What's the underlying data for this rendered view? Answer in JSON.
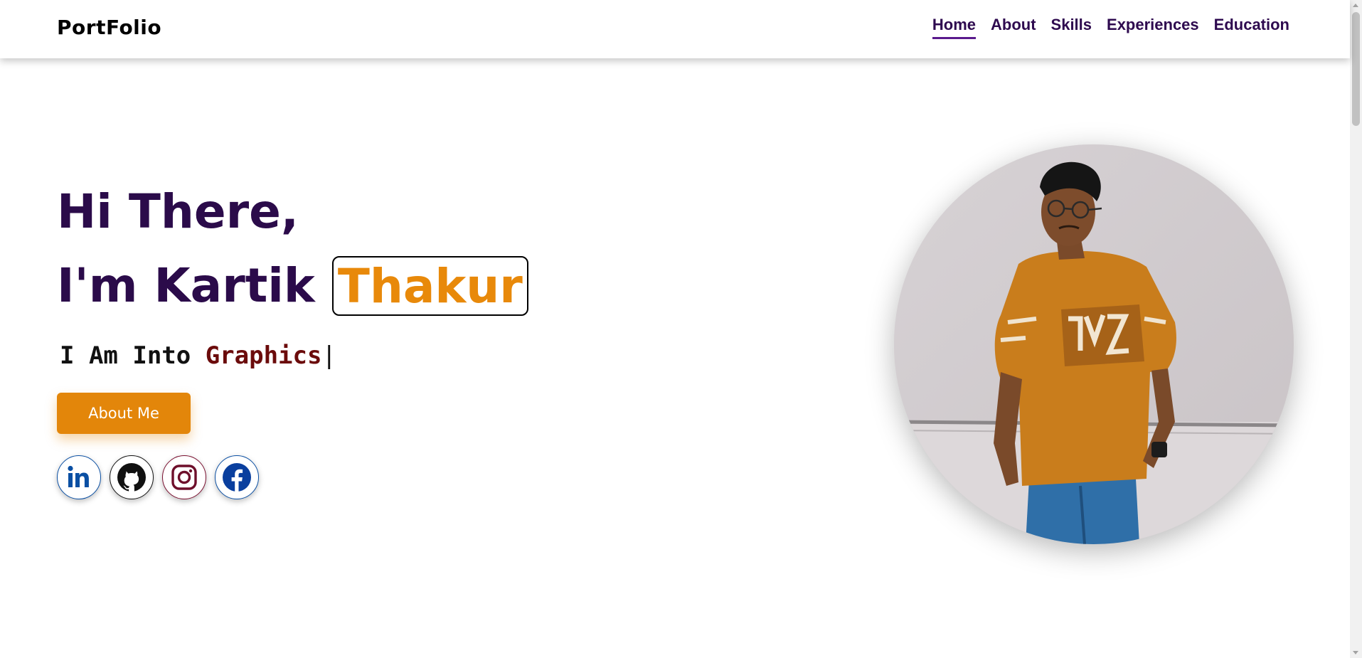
{
  "header": {
    "brand": "PortFolio",
    "nav": [
      {
        "label": "Home",
        "active": true
      },
      {
        "label": "About",
        "active": false
      },
      {
        "label": "Skills",
        "active": false
      },
      {
        "label": "Experiences",
        "active": false
      },
      {
        "label": "Education",
        "active": false
      }
    ]
  },
  "hero": {
    "greeting": "Hi There,",
    "intro_prefix": "I'm Kartik",
    "last_name": "Thakur",
    "typed_prefix": "I Am Into ",
    "typed_word": "Graphics",
    "typed_cursor": "|",
    "about_button": "About Me"
  },
  "socials": [
    {
      "name": "linkedin",
      "icon": "linkedin-icon"
    },
    {
      "name": "github",
      "icon": "github-icon"
    },
    {
      "name": "instagram",
      "icon": "instagram-icon"
    },
    {
      "name": "facebook",
      "icon": "facebook-icon"
    }
  ],
  "colors": {
    "accent": "#e3860a",
    "heading": "#2b0b4a",
    "nav": "#2e0a4f",
    "typed_word": "#6b0b0b"
  }
}
